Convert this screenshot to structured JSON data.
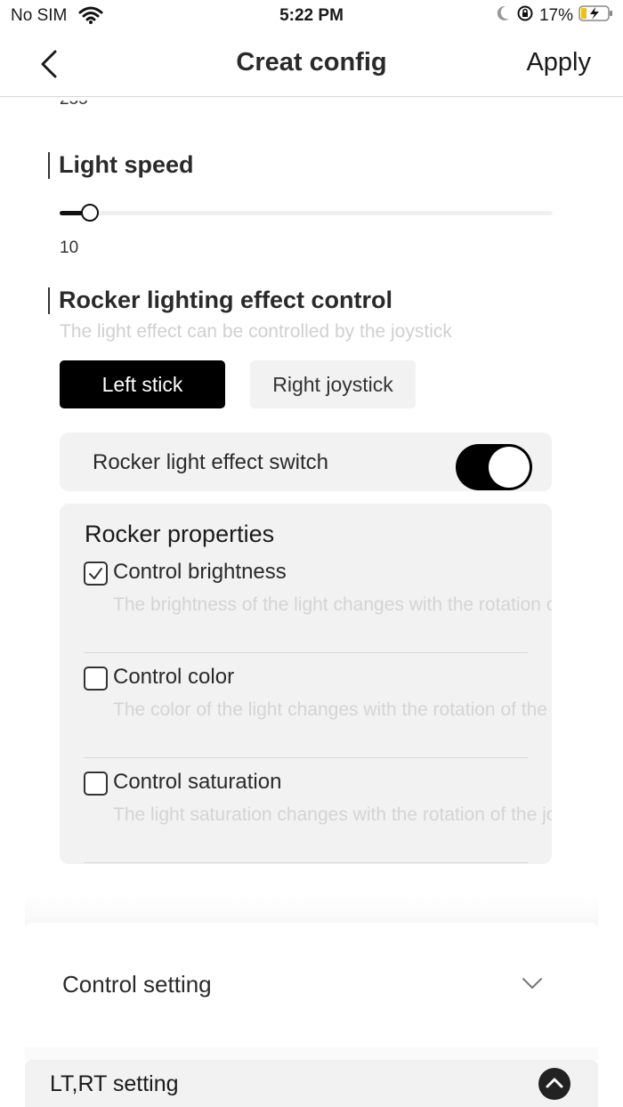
{
  "status_bar": {
    "carrier": "No SIM",
    "time": "5:22 PM",
    "battery": "17%",
    "icons": [
      "wifi-icon",
      "moon-icon",
      "rotation-lock-icon",
      "battery-charging-icon"
    ]
  },
  "nav": {
    "title": "Creat config",
    "apply_label": "Apply",
    "back_icon": "chevron-left-icon"
  },
  "light_speed": {
    "title": "Light speed",
    "value": "10",
    "slider_fraction": 0.045
  },
  "rocker": {
    "title": "Rocker lighting effect control",
    "subtitle": "The light effect can be controlled by the joystick",
    "tabs": [
      {
        "label": "Left stick",
        "active": true
      },
      {
        "label": "Right joystick",
        "active": false
      }
    ],
    "switch_label": "Rocker light effect switch",
    "switch_on": true,
    "properties_title": "Rocker properties",
    "properties": [
      {
        "name": "Control brightness",
        "desc": "The brightness of the light changes with the rotation of the joystick",
        "checked": true
      },
      {
        "name": "Control color",
        "desc": "The color of the light changes with the rotation of the joystick",
        "checked": false
      },
      {
        "name": "Control saturation",
        "desc": "The light saturation changes with the rotation of the joystick",
        "checked": false
      }
    ]
  },
  "control_setting": {
    "label": "Control setting",
    "icon": "chevron-down-icon"
  },
  "lt_rt_setting": {
    "label": "LT,RT setting",
    "icon": "chevron-up-circle-icon"
  },
  "colors": {
    "accent": "#000000",
    "panel": "#f2f2f2",
    "muted_text": "#d0d0d0"
  }
}
